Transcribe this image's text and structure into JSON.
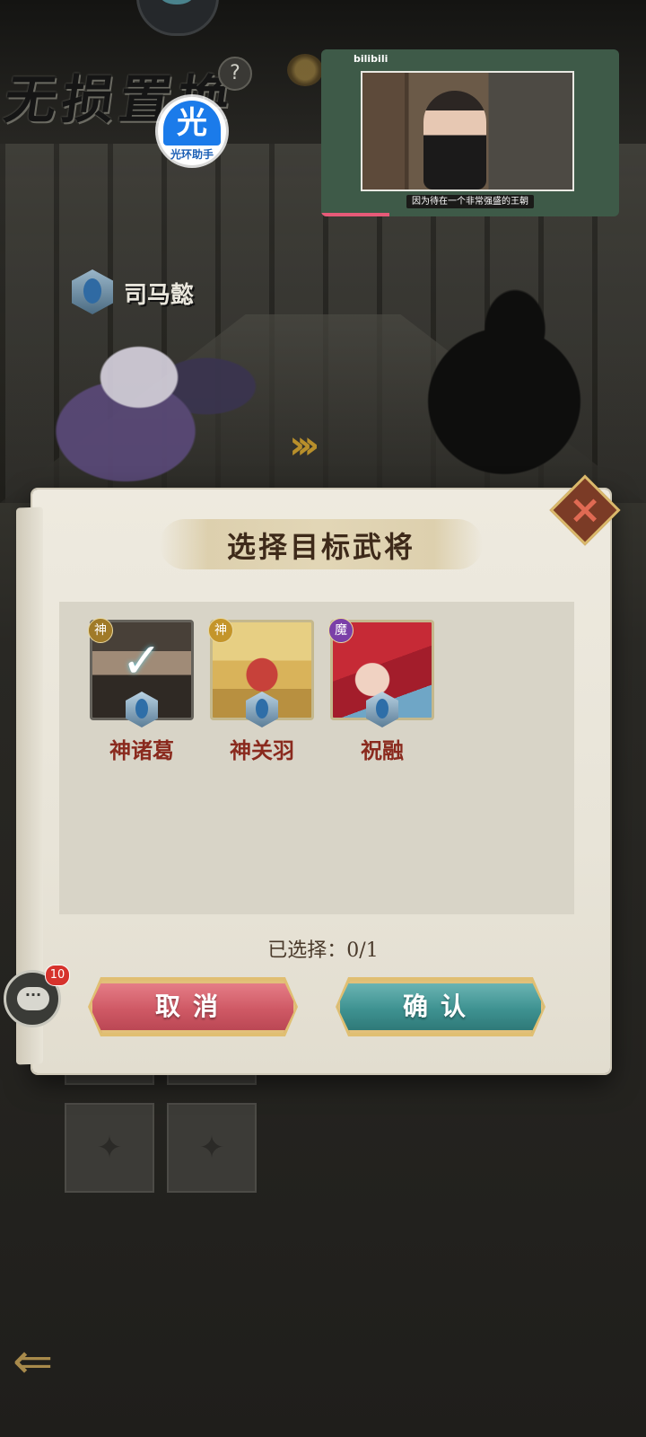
{
  "mode": {
    "title": "无损置换",
    "help_icon": "question-icon"
  },
  "assistant_badge": {
    "glyph": "光",
    "label": "光环助手"
  },
  "video_overlay": {
    "uploader": "",
    "brand": "bilibili",
    "subtitle": "因为待在一个非常强盛的王朝",
    "progress_fraction": 0.23
  },
  "hero": {
    "name": "司马懿"
  },
  "dialog": {
    "title": "选择目标武将",
    "close_icon": "close-x-icon",
    "selected_label": "已选择：0/1",
    "cancel_label": "取消",
    "confirm_label": "确认",
    "candidates": [
      {
        "name": "神诸葛",
        "tag": "神",
        "tag_color": "#a07a28",
        "selected": true
      },
      {
        "name": "神关羽",
        "tag": "神",
        "tag_color": "#c4952a",
        "selected": false
      },
      {
        "name": "祝融",
        "tag": "魔",
        "tag_color": "#7b3fa8",
        "selected": false
      }
    ]
  },
  "chat": {
    "icon": "chat-bubble-icon",
    "badge_count": "10"
  },
  "colors": {
    "cancel": "#cf5965",
    "confirm": "#3e9291",
    "name_text": "#8a2a1e"
  }
}
